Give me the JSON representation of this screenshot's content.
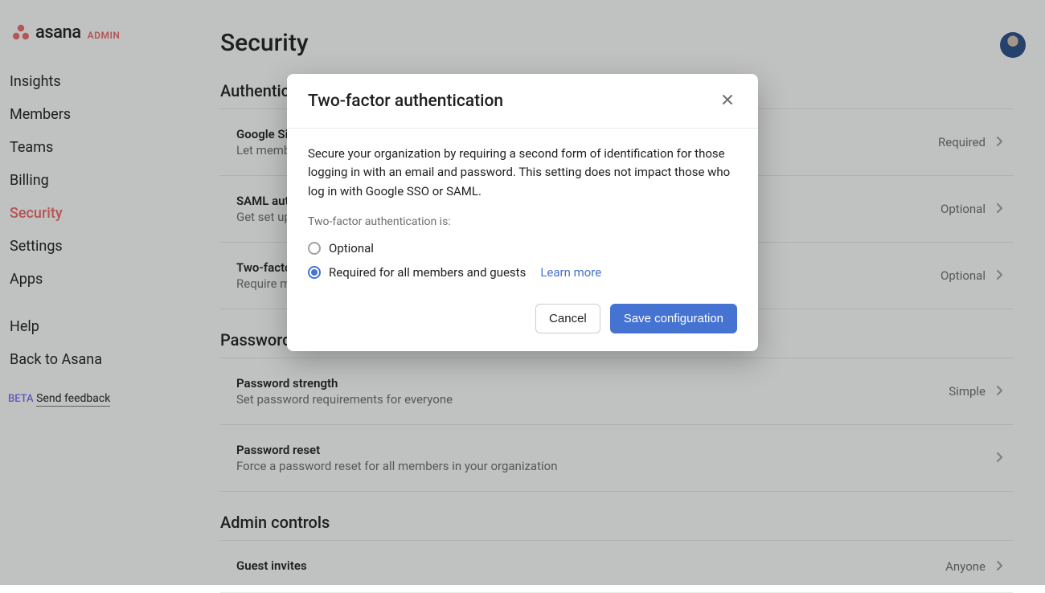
{
  "brand": {
    "name": "asana",
    "admin_label": "ADMIN"
  },
  "sidebar": {
    "items": [
      {
        "label": "Insights"
      },
      {
        "label": "Members"
      },
      {
        "label": "Teams"
      },
      {
        "label": "Billing"
      },
      {
        "label": "Security"
      },
      {
        "label": "Settings"
      },
      {
        "label": "Apps"
      }
    ],
    "secondary": [
      {
        "label": "Help"
      },
      {
        "label": "Back to Asana"
      }
    ],
    "beta_tag": "BETA",
    "feedback_label": "Send feedback"
  },
  "page": {
    "title": "Security"
  },
  "sections": [
    {
      "heading": "Authentication",
      "rows": [
        {
          "title": "Google Sign-In",
          "desc": "Let members sign in with Google",
          "value": "Required"
        },
        {
          "title": "SAML authentication",
          "desc": "Get set up with a SAML identity provider",
          "value": "Optional"
        },
        {
          "title": "Two-factor authentication",
          "desc": "Require members verify identity with a second step",
          "value": "Optional"
        }
      ]
    },
    {
      "heading": "Password settings",
      "rows": [
        {
          "title": "Password strength",
          "desc": "Set password requirements for everyone",
          "value": "Simple"
        },
        {
          "title": "Password reset",
          "desc": "Force a password reset for all members in your organization",
          "value": ""
        }
      ]
    },
    {
      "heading": "Admin controls",
      "rows": [
        {
          "title": "Guest invites",
          "desc": "",
          "value": "Anyone"
        }
      ]
    }
  ],
  "modal": {
    "title": "Two-factor authentication",
    "description": "Secure your organization by requiring a second form of identification for those logging in with an email and password. This setting does not impact those who log in with Google SSO or SAML.",
    "group_label": "Two-factor authentication is:",
    "options": [
      {
        "label": "Optional",
        "checked": false
      },
      {
        "label": "Required for all members and guests",
        "checked": true
      }
    ],
    "learn_more": "Learn more",
    "cancel": "Cancel",
    "save": "Save configuration"
  }
}
